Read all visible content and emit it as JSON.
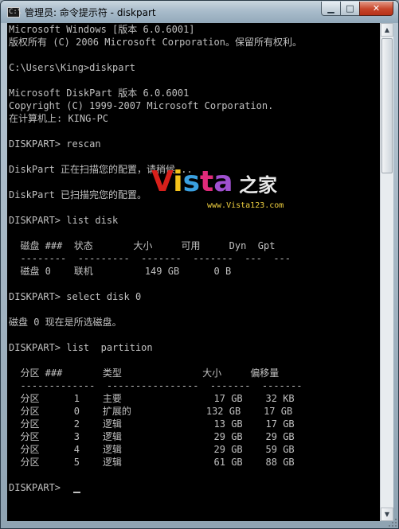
{
  "window": {
    "title": "管理员: 命令提示符 - diskpart",
    "icon_text": "C:\\",
    "buttons": {
      "minimize": "▁",
      "maximize": "□",
      "close": "✕"
    }
  },
  "console_lines": [
    "Microsoft Windows [版本 6.0.6001]",
    "版权所有 (C) 2006 Microsoft Corporation。保留所有权利。",
    "",
    "C:\\Users\\King>diskpart",
    "",
    "Microsoft DiskPart 版本 6.0.6001",
    "Copyright (C) 1999-2007 Microsoft Corporation.",
    "在计算机上: KING-PC",
    "",
    "DISKPART> rescan",
    "",
    "DiskPart 正在扫描您的配置，请稍候...",
    "",
    "DiskPart 已扫描完您的配置。",
    "",
    "DISKPART> list disk",
    "",
    "  磁盘 ###  状态       大小     可用     Dyn  Gpt",
    "  --------  ---------  -------  -------  ---  ---",
    "  磁盘 0    联机         149 GB      0 B",
    "",
    "DISKPART> select disk 0",
    "",
    "磁盘 0 现在是所选磁盘。",
    "",
    "DISKPART> list  partition",
    "",
    "  分区 ###       类型              大小     偏移量",
    "  -------------  ----------------  -------  -------",
    "  分区      1    主要                17 GB    32 KB",
    "  分区      0    扩展的             132 GB    17 GB",
    "  分区      2    逻辑                13 GB    17 GB",
    "  分区      3    逻辑                29 GB    29 GB",
    "  分区      4    逻辑                29 GB    59 GB",
    "  分区      5    逻辑                61 GB    88 GB",
    "",
    "DISKPART> "
  ],
  "watermark": {
    "letters": [
      "V",
      "i",
      "s",
      "t",
      "a"
    ],
    "chinese": "之家",
    "url": "www.Vista123.com"
  },
  "scrollbar": {
    "up": "▲",
    "down": "▼"
  }
}
